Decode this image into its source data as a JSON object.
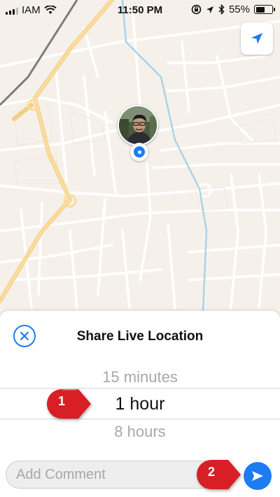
{
  "status_bar": {
    "carrier": "IAM",
    "time": "11:50 PM",
    "battery_percent": "55%",
    "battery_level": 0.55,
    "icons": [
      "signal-bars-icon",
      "wifi-icon",
      "orientation-lock-icon",
      "location-arrow-icon",
      "bluetooth-icon",
      "battery-icon"
    ]
  },
  "map": {
    "icons": [
      "locate-me-icon",
      "user-location-dot-icon"
    ]
  },
  "sheet": {
    "title": "Share Live Location",
    "close_icon": "close-circle-icon",
    "duration_options": [
      "15 minutes",
      "1 hour",
      "8 hours"
    ],
    "selected_duration": "1 hour",
    "comment_placeholder": "Add Comment",
    "send_icon": "send-arrow-icon"
  },
  "callouts": [
    {
      "label": "1",
      "color": "#d81f26"
    },
    {
      "label": "2",
      "color": "#d81f26"
    }
  ],
  "colors": {
    "accent": "#1c7cf2",
    "map_bg": "#f5f1ea",
    "major_road": "#fbdc9b",
    "river": "#a9d3e8",
    "callout": "#d81f26"
  }
}
